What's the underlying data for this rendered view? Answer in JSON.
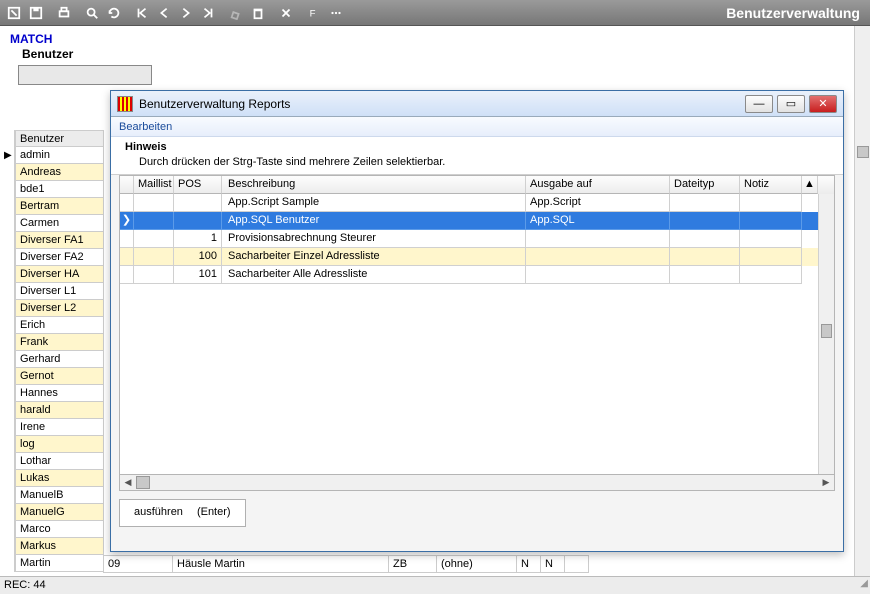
{
  "app": {
    "title": "Benutzerverwaltung"
  },
  "labels": {
    "match": "MATCH",
    "benutzer": "Benutzer"
  },
  "status": {
    "rec": "REC: 44"
  },
  "users": [
    {
      "name": "Benutzer",
      "header": true
    },
    {
      "name": "admin",
      "marker": "▶"
    },
    {
      "name": "Andreas",
      "hl": true
    },
    {
      "name": "bde1"
    },
    {
      "name": "Bertram",
      "hl": true
    },
    {
      "name": "Carmen"
    },
    {
      "name": "Diverser FA1",
      "hl": true
    },
    {
      "name": "Diverser FA2"
    },
    {
      "name": "Diverser HA",
      "hl": true
    },
    {
      "name": "Diverser L1"
    },
    {
      "name": "Diverser L2",
      "hl": true
    },
    {
      "name": "Erich"
    },
    {
      "name": "Frank",
      "hl": true
    },
    {
      "name": "Gerhard"
    },
    {
      "name": "Gernot",
      "hl": true
    },
    {
      "name": "Hannes"
    },
    {
      "name": "harald",
      "hl": true
    },
    {
      "name": "Irene"
    },
    {
      "name": "log",
      "hl": true
    },
    {
      "name": "Lothar"
    },
    {
      "name": "Lukas",
      "hl": true
    },
    {
      "name": "ManuelB"
    },
    {
      "name": "ManuelG",
      "hl": true
    },
    {
      "name": "Marco"
    },
    {
      "name": "Markus",
      "hl": true
    },
    {
      "name": "Martin"
    }
  ],
  "detail": {
    "c0": "09",
    "c1": "Häusle Martin",
    "c2": "ZB",
    "c3": "(ohne)",
    "c4": "N",
    "c5": "N"
  },
  "dialog": {
    "title": "Benutzerverwaltung Reports",
    "menu": "Bearbeiten",
    "hint_head": "Hinweis",
    "hint_body": "Durch drücken der Strg-Taste sind mehrere Zeilen selektierbar.",
    "columns": {
      "maillist": "Maillist",
      "pos": "POS",
      "beschr": "Beschreibung",
      "ausgabe": "Ausgabe auf",
      "dateityp": "Dateityp",
      "notiz": "Notiz"
    },
    "rows": [
      {
        "pos": "",
        "beschr": "App.Script Sample",
        "ausgabe": "App.Script",
        "sel": false,
        "hl": false
      },
      {
        "pos": "",
        "beschr": "App.SQL Benutzer",
        "ausgabe": "App.SQL",
        "sel": true,
        "hl": false,
        "marker": "❯"
      },
      {
        "pos": "1",
        "beschr": "Provisionsabrechnung Steurer",
        "ausgabe": "",
        "sel": false,
        "hl": false
      },
      {
        "pos": "100",
        "beschr": "Sacharbeiter Einzel Adressliste",
        "ausgabe": "",
        "sel": false,
        "hl": true
      },
      {
        "pos": "101",
        "beschr": "Sacharbeiter Alle Adressliste",
        "ausgabe": "",
        "sel": false,
        "hl": false
      }
    ],
    "exec": {
      "label": "ausführen",
      "hint": "(Enter)"
    }
  }
}
